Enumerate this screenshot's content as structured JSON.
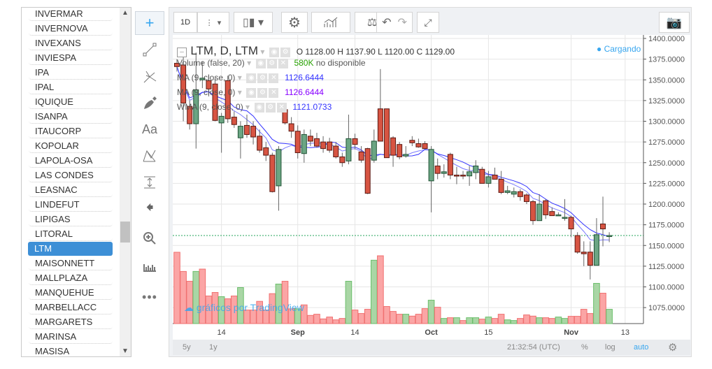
{
  "symbol_list": {
    "items": [
      "INVERMAR",
      "INVERNOVA",
      "INVEXANS",
      "INVIESPA",
      "IPA",
      "IPAL",
      "IQUIQUE",
      "ISANPA",
      "ITAUCORP",
      "KOPOLAR",
      "LAPOLA-OSA",
      "LAS CONDES",
      "LEASNAC",
      "LINDEFUT",
      "LIPIGAS",
      "LITORAL",
      "LTM",
      "MAISONNETT",
      "MALLPLAZA",
      "MANQUEHUE",
      "MARBELLACC",
      "MARGARETS",
      "MARINSA",
      "MASISA"
    ],
    "selected": "LTM"
  },
  "tools": [
    "crosshair-icon",
    "trend-line-icon",
    "pitchfork-icon",
    "brush-icon",
    "text-icon",
    "pattern-icon",
    "measure-icon",
    "arrow-left-icon",
    "zoom-in-icon",
    "ruler-icon",
    "more-icon"
  ],
  "tools_text": {
    "text": "Aa",
    "more": "•••"
  },
  "toolbar": {
    "interval": "1D",
    "camera": "camera-icon"
  },
  "legend": {
    "title": "LTM, D, LTM",
    "o_label": "O",
    "o": "1128.00",
    "h_label": "H",
    "h": "1137.90",
    "l_label": "L",
    "l": "1120.00",
    "c_label": "C",
    "c": "1129.00",
    "status": "Cargando",
    "indicators": [
      {
        "name": "Volume (false, 20)",
        "value": "580K",
        "note": "no disponible"
      },
      {
        "name": "MA (9, close, 0)",
        "value": "1126.6444"
      },
      {
        "name": "MA (9, close, 0)",
        "value": "1126.6444"
      },
      {
        "name": "WMA (9, close, 0)",
        "value": "1121.0733"
      }
    ]
  },
  "watermark": "gráficos por TradingView",
  "bottom": {
    "range_5y": "5y",
    "range_1y": "1y",
    "time": "21:32:54 (UTC)",
    "percent": "%",
    "log": "log",
    "auto": "auto"
  },
  "colors": {
    "up": "#6ba583",
    "down": "#d75442",
    "vol_up": "#a9d6a5",
    "vol_down": "#fba5a5",
    "ma": "#3333ff",
    "wma": "#7a7aff",
    "accent": "#37a6ef",
    "last_price": "#26a65b"
  },
  "chart_data": {
    "type": "candlestick",
    "ylim": [
      1062,
      1405
    ],
    "y_ticks": [
      "1400.0000",
      "1375.0000",
      "1350.0000",
      "1325.0000",
      "1300.0000",
      "1275.0000",
      "1250.0000",
      "1225.0000",
      "1200.0000",
      "1175.0000",
      "1150.0000",
      "1125.0000",
      "1100.0000",
      "1075.0000"
    ],
    "x_ticks": [
      {
        "label": "14",
        "bar": 7
      },
      {
        "label": "Sep",
        "bar": 19
      },
      {
        "label": "14",
        "bar": 28
      },
      {
        "label": "Oct",
        "bar": 40
      },
      {
        "label": "15",
        "bar": 49
      },
      {
        "label": "Nov",
        "bar": 62
      },
      {
        "label": "13",
        "bar": 70.5
      }
    ],
    "last_price": 1162,
    "ohlc": [
      [
        1370,
        1375,
        1360,
        1366
      ],
      [
        1368,
        1378,
        1300,
        1322
      ],
      [
        1318,
        1325,
        1290,
        1297
      ],
      [
        1297,
        1383,
        1267,
        1338
      ],
      [
        1350,
        1372,
        1340,
        1352
      ],
      [
        1349,
        1355,
        1330,
        1339
      ],
      [
        1345,
        1352,
        1300,
        1301
      ],
      [
        1298,
        1310,
        1262,
        1306
      ],
      [
        1349,
        1355,
        1298,
        1303
      ],
      [
        1305,
        1312,
        1292,
        1296
      ],
      [
        1280,
        1300,
        1255,
        1294
      ],
      [
        1295,
        1308,
        1280,
        1284
      ],
      [
        1294,
        1300,
        1272,
        1281
      ],
      [
        1282,
        1290,
        1262,
        1265
      ],
      [
        1268,
        1275,
        1252,
        1259
      ],
      [
        1259,
        1262,
        1214,
        1215
      ],
      [
        1222,
        1270,
        1192,
        1266
      ],
      [
        1314,
        1320,
        1296,
        1298
      ],
      [
        1297,
        1305,
        1280,
        1288
      ],
      [
        1288,
        1295,
        1255,
        1262
      ],
      [
        1261,
        1290,
        1250,
        1284
      ],
      [
        1282,
        1290,
        1270,
        1276
      ],
      [
        1279,
        1286,
        1268,
        1270
      ],
      [
        1275,
        1282,
        1262,
        1267
      ],
      [
        1275,
        1280,
        1262,
        1265
      ],
      [
        1270,
        1275,
        1255,
        1257
      ],
      [
        1257,
        1262,
        1245,
        1250
      ],
      [
        1252,
        1308,
        1248,
        1279
      ],
      [
        1279,
        1285,
        1266,
        1272
      ],
      [
        1263,
        1270,
        1250,
        1253
      ],
      [
        1267,
        1268,
        1212,
        1213
      ],
      [
        1253,
        1290,
        1250,
        1276
      ],
      [
        1315,
        1363,
        1276,
        1276
      ],
      [
        1315,
        1315,
        1256,
        1256
      ],
      [
        1280,
        1282,
        1245,
        1259
      ],
      [
        1272,
        1275,
        1254,
        1257
      ],
      [
        1258,
        1270,
        1256,
        1260
      ],
      [
        1277,
        1282,
        1270,
        1274
      ],
      [
        1273,
        1279,
        1268,
        1269
      ],
      [
        1273,
        1276,
        1266,
        1267
      ],
      [
        1228,
        1270,
        1190,
        1266
      ],
      [
        1246,
        1255,
        1230,
        1237
      ],
      [
        1237,
        1248,
        1232,
        1239
      ],
      [
        1260,
        1262,
        1230,
        1235
      ],
      [
        1235,
        1245,
        1224,
        1235
      ],
      [
        1235,
        1240,
        1230,
        1234
      ],
      [
        1234,
        1246,
        1222,
        1239
      ],
      [
        1238,
        1253,
        1230,
        1246
      ],
      [
        1242,
        1245,
        1225,
        1225
      ],
      [
        1225,
        1240,
        1220,
        1233
      ],
      [
        1235,
        1244,
        1230,
        1230
      ],
      [
        1230,
        1240,
        1212,
        1214
      ],
      [
        1214,
        1222,
        1212,
        1216
      ],
      [
        1212,
        1220,
        1208,
        1215
      ],
      [
        1215,
        1218,
        1204,
        1209
      ],
      [
        1211,
        1213,
        1200,
        1203
      ],
      [
        1203,
        1205,
        1175,
        1180
      ],
      [
        1180,
        1212,
        1180,
        1200
      ],
      [
        1204,
        1206,
        1182,
        1187
      ],
      [
        1191,
        1196,
        1186,
        1186
      ],
      [
        1186,
        1190,
        1186,
        1187
      ],
      [
        1183,
        1206,
        1180,
        1184
      ],
      [
        1184,
        1186,
        1160,
        1170
      ],
      [
        1162,
        1166,
        1140,
        1142
      ],
      [
        1142,
        1155,
        1125,
        1140
      ],
      [
        1142,
        1155,
        1109,
        1126
      ],
      [
        1126,
        1183,
        1126,
        1163
      ],
      [
        1176,
        1209,
        1149,
        1170
      ],
      [
        1161,
        1166,
        1154,
        1162
      ]
    ],
    "volume_k": [
      2898,
      2119,
      1720,
      2119,
      2214,
      1121,
      1264,
      1093,
      1007,
      1121,
      1463,
      551,
      551,
      903,
      551,
      1216,
      1606,
      1720,
      599,
      599,
      760,
      333,
      380,
      190,
      266,
      152,
      209,
      1720,
      551,
      409,
      580,
      2575,
      2755,
      694,
      494,
      380,
      380,
      304,
      380,
      608,
      950,
      665,
      209,
      238,
      238,
      124,
      238,
      238,
      181,
      266,
      209,
      380,
      152,
      124,
      209,
      352,
      304,
      238,
      238,
      209,
      266,
      209,
      295,
      295,
      580,
      409,
      1634,
      1235,
      580
    ],
    "volume_dir": "dddguddgddgdddddgddgdddddddgdddgddddgdddgdgdgdggdgddggdddgddggddddgdg"
  }
}
